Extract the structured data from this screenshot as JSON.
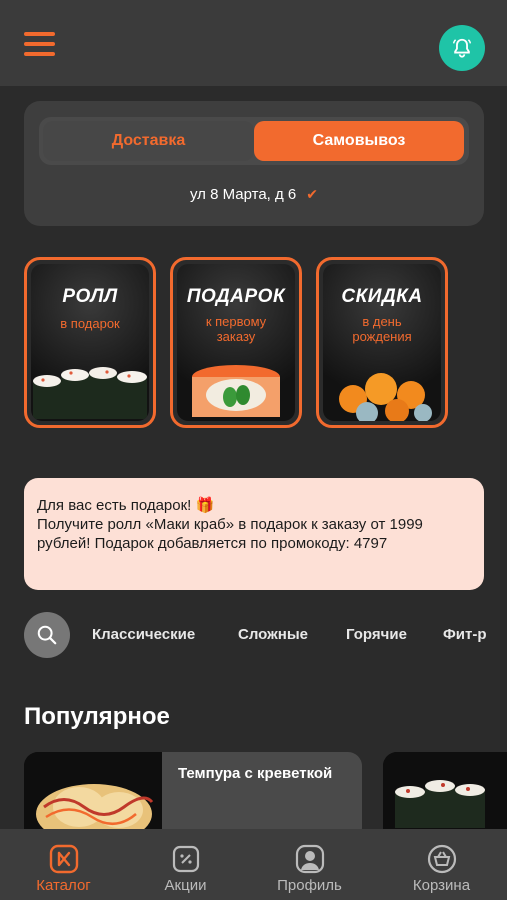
{
  "header": {
    "menu_icon": "menu-icon",
    "bell_icon": "bell-icon"
  },
  "delivery": {
    "delivery_label": "Доставка",
    "pickup_label": "Самовывоз",
    "selected": "pickup",
    "address": "ул 8 Марта, д 6"
  },
  "stories": [
    {
      "title": "РОЛЛ",
      "subtitle_line1": "в подарок",
      "subtitle_line2": ""
    },
    {
      "title": "ПОДАРОК",
      "subtitle_line1": "к первому",
      "subtitle_line2": "заказу"
    },
    {
      "title": "СКИДКА",
      "subtitle_line1": "в день",
      "subtitle_line2": "рождения"
    }
  ],
  "promo": {
    "title": "Для вас есть подарок! 🎁",
    "text": "Получите ролл «Маки краб» в подарок к заказу от 1999 рублей! Подарок добавляется по промокоду: 4797"
  },
  "categories": [
    "Классические",
    "Сложные",
    "Горячие",
    "Фит-р"
  ],
  "popular": {
    "title": "Популярное",
    "products": [
      {
        "name": "Темпура с креветкой"
      }
    ]
  },
  "tabbar": {
    "items": [
      {
        "label": "Каталог",
        "icon": "catalog-icon",
        "active": true
      },
      {
        "label": "Акции",
        "icon": "discount-icon",
        "active": false
      },
      {
        "label": "Профиль",
        "icon": "profile-icon",
        "active": false
      },
      {
        "label": "Корзина",
        "icon": "basket-icon",
        "active": false
      }
    ]
  },
  "colors": {
    "accent": "#f26a2e",
    "bell_bg": "#1fc4a7",
    "promo_bg": "#fde0d6",
    "background": "#2b2b2b"
  }
}
